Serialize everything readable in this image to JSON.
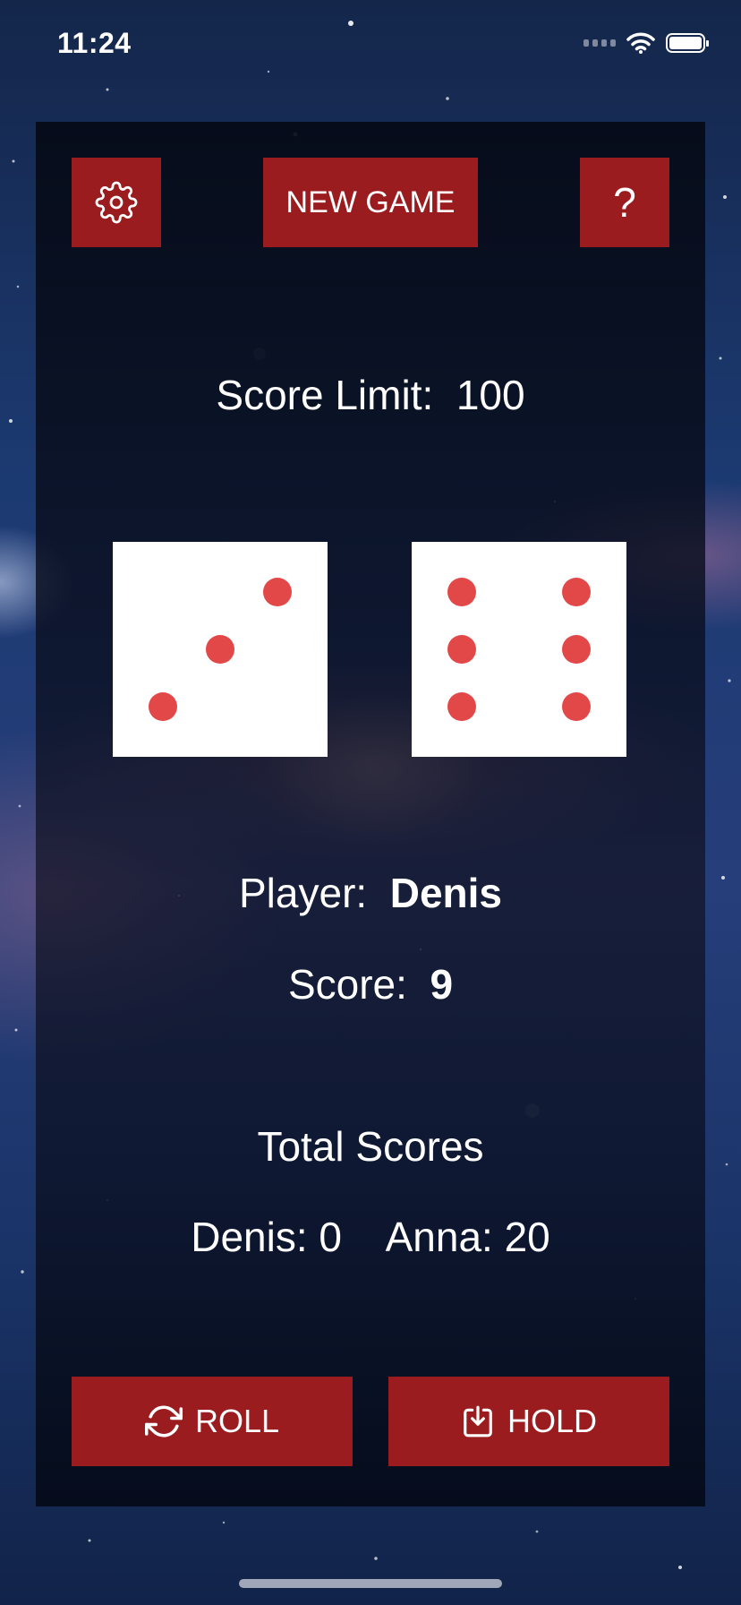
{
  "status_bar": {
    "time": "11:24"
  },
  "toolbar": {
    "new_game_label": "NEW GAME",
    "help_label": "?"
  },
  "score_limit": {
    "label": "Score Limit:",
    "value": "100"
  },
  "dice": [
    3,
    6
  ],
  "current": {
    "player_label": "Player:",
    "player_name": "Denis",
    "score_label": "Score:",
    "score_value": "9"
  },
  "totals": {
    "title": "Total Scores",
    "players": [
      {
        "name": "Denis:",
        "score": "0"
      },
      {
        "name": "Anna:",
        "score": "20"
      }
    ]
  },
  "actions": {
    "roll_label": "ROLL",
    "hold_label": "HOLD"
  },
  "colors": {
    "button": "#9b1c1f",
    "pip": "#e34848",
    "die_face": "#ffffff"
  }
}
